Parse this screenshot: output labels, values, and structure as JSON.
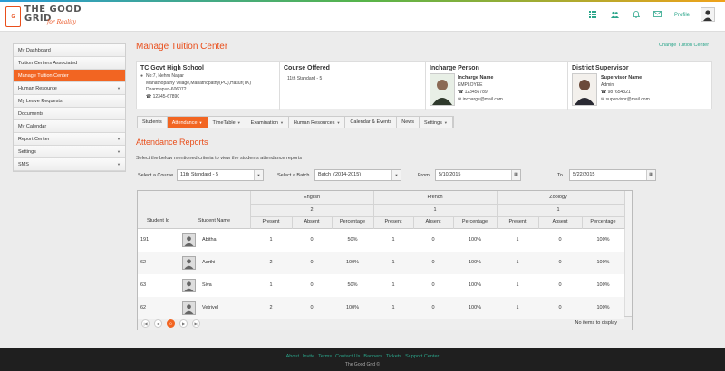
{
  "brand": {
    "line1": "THE GOOD",
    "line2": "GRID",
    "tagline": "for Reality",
    "badge": "G"
  },
  "header": {
    "profile": "Profile",
    "icons": [
      "grid-icon",
      "users-icon",
      "bell-icon",
      "mail-icon"
    ]
  },
  "sidebar": {
    "items": [
      {
        "label": "My Dashboard",
        "arrow": false,
        "active": false
      },
      {
        "label": "Tuition Centers Associated",
        "arrow": false,
        "active": false
      },
      {
        "label": "Manage Tuition Center",
        "arrow": false,
        "active": true
      },
      {
        "label": "Human Resource",
        "arrow": true,
        "active": false
      },
      {
        "label": "My Leave Requests",
        "arrow": false,
        "active": false
      },
      {
        "label": "Documents",
        "arrow": false,
        "active": false
      },
      {
        "label": "My Calendar",
        "arrow": false,
        "active": false
      },
      {
        "label": "Report Center",
        "arrow": true,
        "active": false
      },
      {
        "label": "Settings",
        "arrow": true,
        "active": false
      },
      {
        "label": "SMS",
        "arrow": true,
        "active": false
      }
    ]
  },
  "page": {
    "title": "Manage Tuition Center",
    "change_link": "Change Tuition Center"
  },
  "info": {
    "school": {
      "name": "TC Govt High School",
      "addr1": "No:7, Nehru Nagar",
      "addr2": "Manathopathy Village,Manathopathy(PO),Hasur(TK)",
      "addr3": "Dharmapuri-606072",
      "phone": "12345-67890"
    },
    "course": {
      "head": "Course Offered",
      "value": "11th Standard - 5"
    },
    "incharge": {
      "head": "Incharge Person",
      "name": "Incharge Name",
      "role": "EMPLOYEE",
      "phone": "123456789",
      "email": "incharge@mail.com"
    },
    "supervisor": {
      "head": "District Supervisor",
      "name": "Supervisor Name",
      "role": "Admin",
      "phone": "987654321",
      "email": "supervisor@mail.com"
    }
  },
  "tabs": [
    {
      "label": "Students",
      "caret": false,
      "active": false
    },
    {
      "label": "Attendance",
      "caret": true,
      "active": true
    },
    {
      "label": "TimeTable",
      "caret": true,
      "active": false
    },
    {
      "label": "Examination",
      "caret": true,
      "active": false
    },
    {
      "label": "Human Resources",
      "caret": true,
      "active": false
    },
    {
      "label": "Calendar & Events",
      "caret": false,
      "active": false
    },
    {
      "label": "News",
      "caret": false,
      "active": false
    },
    {
      "label": "Settings",
      "caret": true,
      "active": false
    }
  ],
  "report": {
    "title": "Attendance Reports",
    "hint": "Select the below mentioned criteria to view the students attendance reports",
    "course_label": "Select a Course",
    "course_value": "11th Standard - 5",
    "batch_label": "Select a Batch",
    "batch_value": "Batch I(2014-2015)",
    "from_label": "From",
    "from_value": "5/10/2015",
    "to_label": "To",
    "to_value": "5/22/2015"
  },
  "table": {
    "col_id": "Student Id",
    "col_name": "Student Name",
    "subjects": [
      {
        "name": "English",
        "count": "2"
      },
      {
        "name": "French",
        "count": "1"
      },
      {
        "name": "Zoology",
        "count": "1"
      }
    ],
    "sub_headers": [
      "Present",
      "Absent",
      "Percentage"
    ],
    "rows": [
      {
        "id": "191",
        "name": "Abitha",
        "cells": [
          "1",
          "0",
          "50%",
          "1",
          "0",
          "100%",
          "1",
          "0",
          "100%"
        ]
      },
      {
        "id": "62",
        "name": "Aarthi",
        "cells": [
          "2",
          "0",
          "100%",
          "1",
          "0",
          "100%",
          "1",
          "0",
          "100%"
        ]
      },
      {
        "id": "63",
        "name": "Siva",
        "cells": [
          "1",
          "0",
          "50%",
          "1",
          "0",
          "100%",
          "1",
          "0",
          "100%"
        ]
      },
      {
        "id": "62",
        "name": "Vetrivel",
        "cells": [
          "2",
          "0",
          "100%",
          "1",
          "0",
          "100%",
          "1",
          "0",
          "100%"
        ]
      }
    ],
    "pager": {
      "current": "0",
      "empty": "No items to display"
    }
  },
  "footer": {
    "links": [
      "About",
      "Invite",
      "Terms",
      "Contact Us",
      "Banners",
      "Tickets",
      "Support Center"
    ],
    "copyright": "The Good Grid ©"
  }
}
